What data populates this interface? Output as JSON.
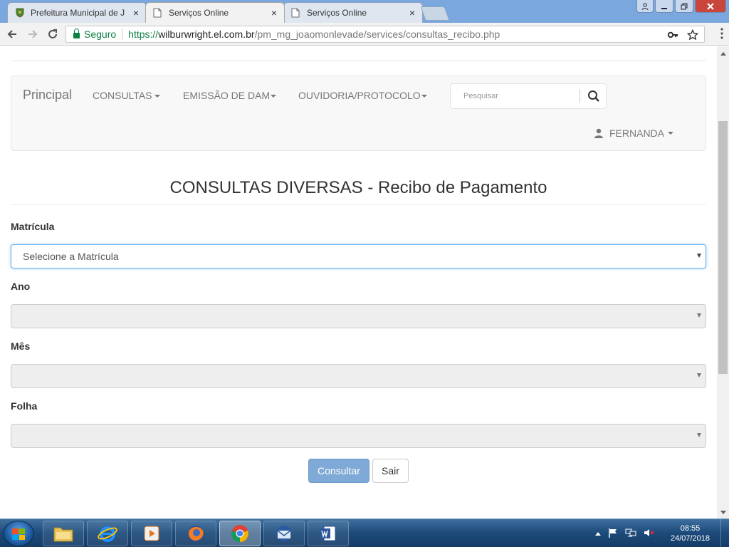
{
  "browser": {
    "tabs": [
      {
        "label": "Prefeitura Municipal de J",
        "active": false
      },
      {
        "label": "Serviços Online",
        "active": true
      },
      {
        "label": "Serviços Online",
        "active": false
      }
    ],
    "close_glyph": "×",
    "secure_label": "Seguro",
    "url": {
      "scheme": "https://",
      "host": "wilburwright.el.com.br",
      "path": "/pm_mg_joaomonlevade/services/consultas_recibo.php"
    }
  },
  "navbar": {
    "brand": "Principal",
    "items": [
      {
        "label": "CONSULTAS"
      },
      {
        "label": "EMISSÃO DE DAM"
      },
      {
        "label": "OUVIDORIA/PROTOCOLO"
      }
    ],
    "search_placeholder": "Pesquisar",
    "user_name": "FERNANDA"
  },
  "page": {
    "title": "CONSULTAS DIVERSAS - Recibo de Pagamento"
  },
  "form": {
    "fields": [
      {
        "label": "Matrícula",
        "value": "Selecione a Matrícula",
        "enabled": true
      },
      {
        "label": "Ano",
        "value": "",
        "enabled": false
      },
      {
        "label": "Mês",
        "value": "",
        "enabled": false
      },
      {
        "label": "Folha",
        "value": "",
        "enabled": false
      }
    ],
    "submit_label": "Consultar",
    "exit_label": "Sair"
  },
  "taskbar": {
    "time": "08:55",
    "date": "24/07/2018"
  },
  "colors": {
    "primary_button": "#7fa9d6",
    "secure_green": "#0b8043",
    "select_focus": "#66afe9"
  }
}
